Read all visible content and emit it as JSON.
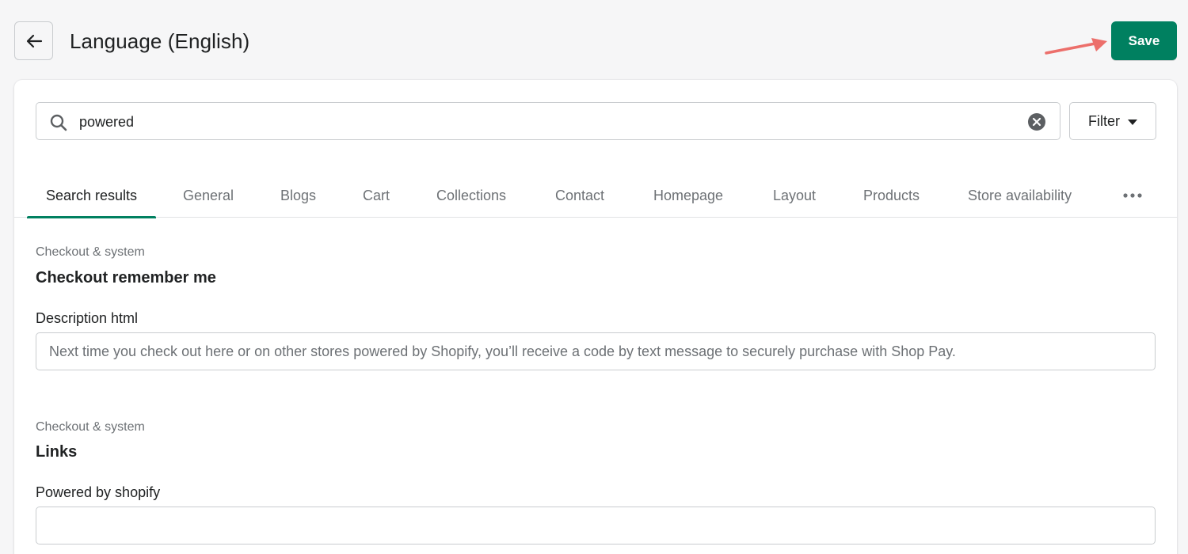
{
  "header": {
    "title": "Language (English)",
    "save_label": "Save",
    "accent_color": "#008060"
  },
  "search": {
    "value": "powered",
    "placeholder": "",
    "filter_label": "Filter"
  },
  "tabs": [
    {
      "label": "Search results",
      "active": true
    },
    {
      "label": "General",
      "active": false
    },
    {
      "label": "Blogs",
      "active": false
    },
    {
      "label": "Cart",
      "active": false
    },
    {
      "label": "Collections",
      "active": false
    },
    {
      "label": "Contact",
      "active": false
    },
    {
      "label": "Homepage",
      "active": false
    },
    {
      "label": "Layout",
      "active": false
    },
    {
      "label": "Products",
      "active": false
    },
    {
      "label": "Store availability",
      "active": false
    }
  ],
  "sections": [
    {
      "category": "Checkout & system",
      "title": "Checkout remember me",
      "field_label": "Description html",
      "field_placeholder": "Next time you check out here or on other stores powered by Shopify, you’ll receive a code by text message to securely purchase with Shop Pay.",
      "field_value": ""
    },
    {
      "category": "Checkout & system",
      "title": "Links",
      "field_label": "Powered by shopify",
      "field_placeholder": "",
      "field_value": ""
    }
  ],
  "icons": {
    "back": "arrow-left-icon",
    "search": "search-icon",
    "clear": "clear-circle-icon",
    "filter_caret": "caret-down-icon",
    "more": "more-horizontal-icon",
    "annotation": "red-arrow-annotation"
  }
}
